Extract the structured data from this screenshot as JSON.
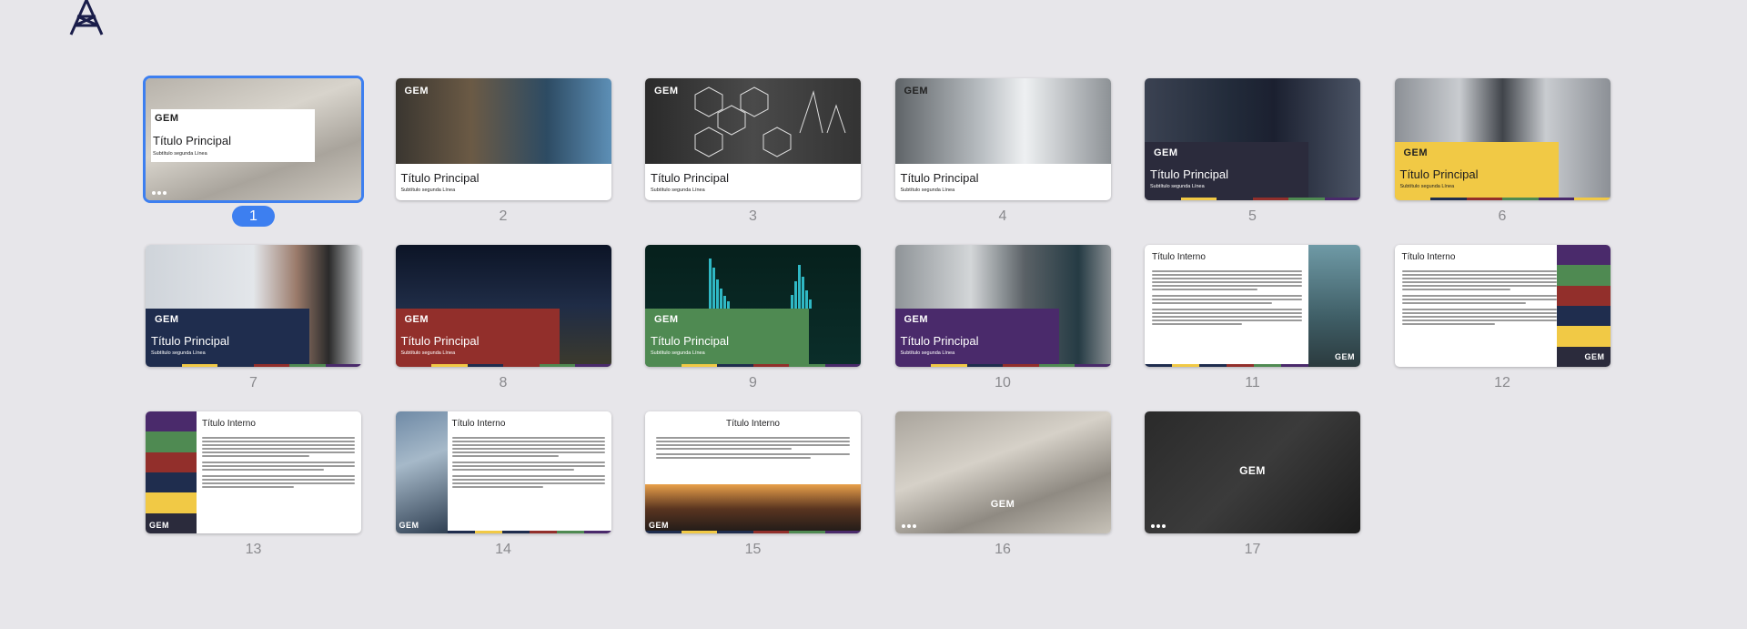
{
  "brand": "GEM",
  "selected_index": 1,
  "colors": {
    "accent": "#3d7ff0",
    "navy": "#1f2d4e",
    "yellow": "#f1c945",
    "red": "#922f2b",
    "green": "#4f8a52",
    "purple": "#4a2a6b",
    "dark": "#2b2b3c"
  },
  "slides": [
    {
      "number": "1",
      "title": "Título Principal",
      "subtitle": "Subtítulo segunda Línea"
    },
    {
      "number": "2",
      "title": "Título Principal",
      "subtitle": "Subtítulo segunda Línea"
    },
    {
      "number": "3",
      "title": "Título Principal",
      "subtitle": "Subtítulo segunda Línea"
    },
    {
      "number": "4",
      "title": "Título Principal",
      "subtitle": "Subtítulo segunda Línea"
    },
    {
      "number": "5",
      "title": "Título Principal",
      "subtitle": "Subtítulo segunda Línea"
    },
    {
      "number": "6",
      "title": "Título Principal",
      "subtitle": "Subtítulo segunda Línea"
    },
    {
      "number": "7",
      "title": "Título Principal",
      "subtitle": "Subtítulo segunda Línea"
    },
    {
      "number": "8",
      "title": "Título Principal",
      "subtitle": "Subtítulo segunda Línea"
    },
    {
      "number": "9",
      "title": "Título Principal",
      "subtitle": "Subtítulo segunda Línea"
    },
    {
      "number": "10",
      "title": "Título Principal",
      "subtitle": "Subtítulo segunda Línea"
    },
    {
      "number": "11",
      "title": "Título Interno"
    },
    {
      "number": "12",
      "title": "Título Interno"
    },
    {
      "number": "13",
      "title": "Título Interno"
    },
    {
      "number": "14",
      "title": "Título Interno"
    },
    {
      "number": "15",
      "title": "Título Interno"
    },
    {
      "number": "16"
    },
    {
      "number": "17"
    }
  ]
}
